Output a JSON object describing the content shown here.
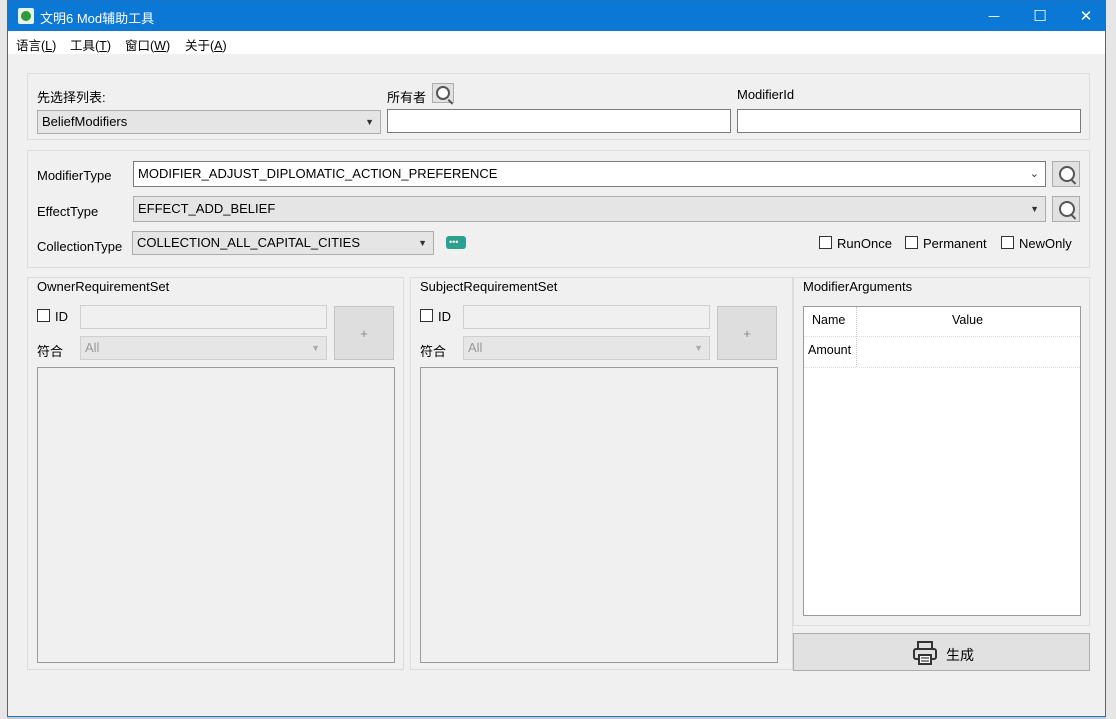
{
  "window": {
    "title": "文明6 Mod辅助工具"
  },
  "caption_buttons": {
    "minimize": "—",
    "maximize": "☐",
    "close": "✕"
  },
  "menu": {
    "items": [
      {
        "label": "语言(",
        "key": "L",
        "tail": ")"
      },
      {
        "label": "工具(",
        "key": "T",
        "tail": ")"
      },
      {
        "label": "窗口(",
        "key": "W",
        "tail": ")"
      },
      {
        "label": "关于(",
        "key": "A",
        "tail": ")"
      }
    ]
  },
  "top_panel": {
    "list_label": "先选择列表:",
    "list_value": "BeliefModifiers",
    "owner_label": "所有者",
    "owner_value": "",
    "modifier_id_label": "ModifierId",
    "modifier_id_value": ""
  },
  "type_panel": {
    "modifier_type_label": "ModifierType",
    "modifier_type_value": "MODIFIER_ADJUST_DIPLOMATIC_ACTION_PREFERENCE",
    "effect_type_label": "EffectType",
    "effect_type_value": "EFFECT_ADD_BELIEF",
    "collection_type_label": "CollectionType",
    "collection_type_value": "COLLECTION_ALL_CAPITAL_CITIES",
    "run_once_label": "RunOnce",
    "run_once_checked": false,
    "permanent_label": "Permanent",
    "permanent_checked": false,
    "new_only_label": "NewOnly",
    "new_only_checked": false
  },
  "owner_req": {
    "title": "OwnerRequirementSet",
    "id_label": "ID",
    "id_value": "",
    "match_label": "符合",
    "match_value": "All",
    "add_label": "+"
  },
  "subject_req": {
    "title": "SubjectRequirementSet",
    "id_label": "ID",
    "id_value": "",
    "match_label": "符合",
    "match_value": "All",
    "add_label": "+"
  },
  "modifier_args": {
    "title": "ModifierArguments",
    "columns": {
      "name": "Name",
      "value": "Value"
    },
    "rows": [
      {
        "name": "Amount",
        "value": ""
      }
    ]
  },
  "generate": {
    "label": "生成"
  },
  "colors": {
    "titlebar": "#0a78d4",
    "chat_icon": "#2d9f8f"
  }
}
